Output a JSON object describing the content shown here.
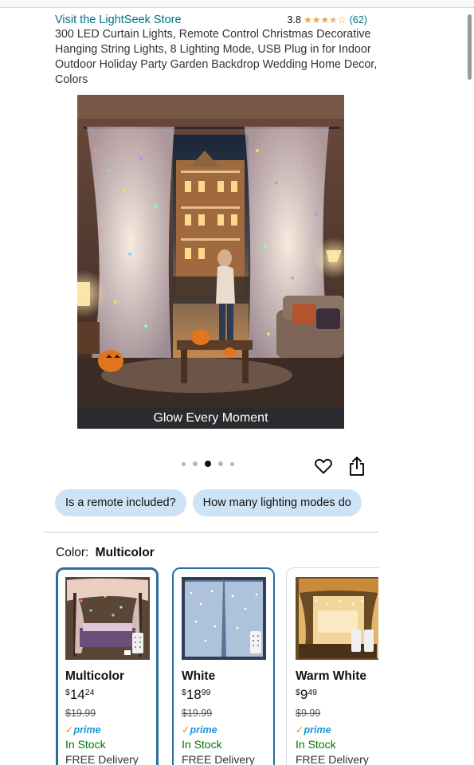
{
  "store": {
    "link": "Visit the LightSeek Store",
    "rating": "3.8",
    "stars": 3.8,
    "review_count": "(62)"
  },
  "product": {
    "title": "300 LED Curtain Lights, Remote Control Christmas Decorative Hanging String Lights, 8 Lighting Mode, USB Plug in for Indoor Outdoor Holiday Party Garden Backdrop Wedding Home Decor, Colors"
  },
  "gallery": {
    "caption": "Glow Every Moment",
    "image_count": 5,
    "active_index": 2
  },
  "actions": {
    "heart_icon": "heart-icon",
    "share_icon": "share-icon"
  },
  "questions": [
    {
      "label": "Is a remote included?"
    },
    {
      "label": "How many lighting modes do"
    }
  ],
  "color": {
    "label": "Color:",
    "selected": "Multicolor"
  },
  "swatches": [
    {
      "name": "Multicolor",
      "symbol": "$",
      "dollars": "14",
      "cents": "24",
      "list_price": "$19.99",
      "prime": "prime",
      "stock": "In Stock",
      "delivery": "FREE Delivery"
    },
    {
      "name": "White",
      "symbol": "$",
      "dollars": "18",
      "cents": "99",
      "list_price": "$19.99",
      "prime": "prime",
      "stock": "In Stock",
      "delivery": "FREE Delivery"
    },
    {
      "name": "Warm White",
      "symbol": "$",
      "dollars": "9",
      "cents": "49",
      "list_price": "$9.99",
      "prime": "prime",
      "stock": "In Stock",
      "delivery": "FREE Delivery"
    }
  ],
  "colors": {
    "link": "#007185",
    "star": "#f2a43a",
    "chip_bg": "#cfe3f7",
    "selected_border": "#2a6f9e",
    "prime": "#1399d8",
    "in_stock": "#007600"
  }
}
